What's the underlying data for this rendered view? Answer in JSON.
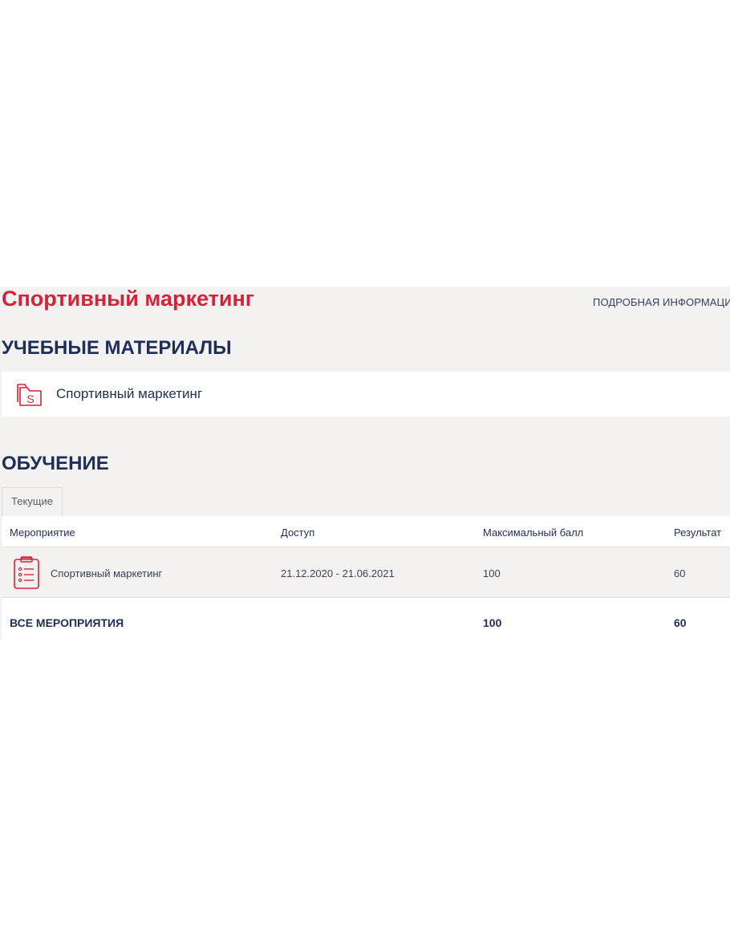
{
  "header": {
    "title": "Спортивный маркетинг",
    "info_link": "ПОДРОБНАЯ ИНФОРМАЦИ"
  },
  "materials": {
    "heading": "УЧЕБНЫЕ МАТЕРИАЛЫ",
    "items": [
      {
        "label": "Спортивный маркетинг",
        "icon": "folder-s-icon"
      }
    ]
  },
  "training": {
    "heading": "ОБУЧЕНИЕ",
    "tabs": [
      {
        "label": "Текущие",
        "active": true
      }
    ],
    "columns": [
      "Мероприятие",
      "Доступ",
      "Максимальный балл",
      "Результат"
    ],
    "rows": [
      {
        "icon": "checklist-icon",
        "event": "Спортивный маркетинг",
        "access": "21.12.2020 - 21.06.2021",
        "max_score": "100",
        "result": "60"
      }
    ],
    "total": {
      "label": "ВСЕ МЕРОПРИЯТИЯ",
      "max_score": "100",
      "result": "60"
    }
  },
  "colors": {
    "accent_red": "#d2233a",
    "heading_navy": "#1f2e57",
    "panel_bg": "#f3f2f0"
  }
}
